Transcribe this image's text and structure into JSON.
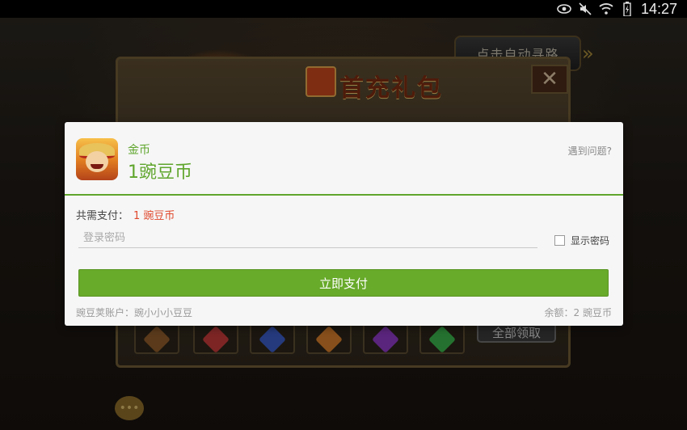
{
  "status_bar": {
    "time": "14:27",
    "icons": [
      "eye-icon",
      "mute-icon",
      "wifi-icon",
      "battery-charging-icon"
    ]
  },
  "game": {
    "auto_path_label": "点击自动寻路",
    "panel_title": "首充礼包",
    "close_glyph": "✕",
    "claim_all_label": "全部领取",
    "gem_colors": [
      "#8a5a2a",
      "#c03a3a",
      "#3a5ac0",
      "#d07a2a",
      "#8a3ac0",
      "#3ab04a"
    ]
  },
  "dialog": {
    "item_name": "金币",
    "item_amount": "1豌豆币",
    "help_link": "遇到问题?",
    "total_label": "共需支付：",
    "total_value": "1 豌豆币",
    "password_placeholder": "登录密码",
    "password_value": "",
    "show_password_label": "显示密码",
    "pay_button_label": "立即支付",
    "account_text": "豌豆荚账户：豌小小小豆豆",
    "balance_text": "余额：2 豌豆币"
  },
  "colors": {
    "accent_green": "#68aa2a",
    "price_red": "#e0482c"
  }
}
